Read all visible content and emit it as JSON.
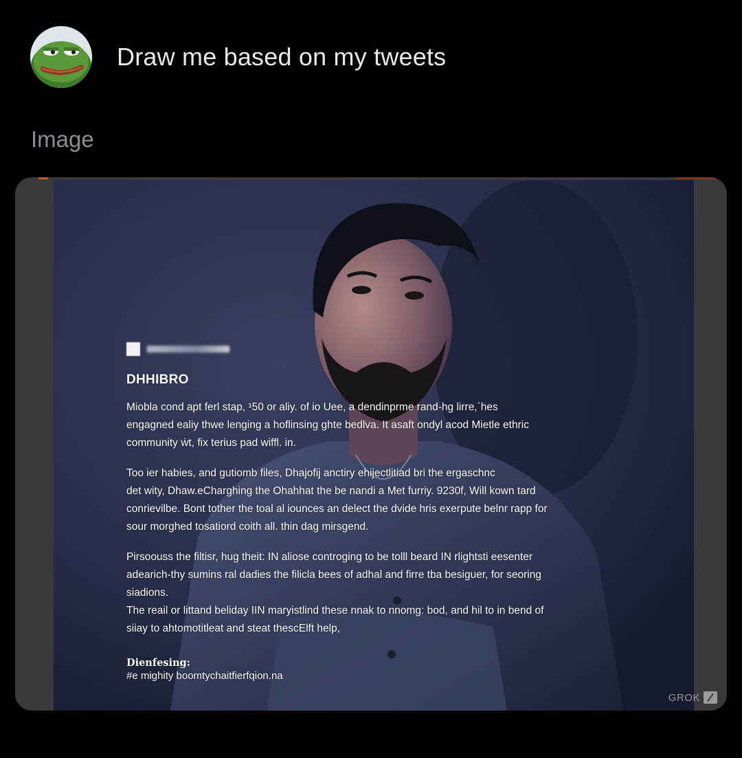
{
  "prompt": {
    "avatar_icon": "frog-avatar-icon",
    "text": "Draw me based on my tweets"
  },
  "section_label": "Image",
  "image": {
    "overlay": {
      "title": "DHHIBRO",
      "paragraph1": [
        "Miobla cond apt ferl stap, ¹50 or aliy. of io Uee, a dendinprme rand-hg lirre,`hes",
        "engagned ealiy thwe lenging a hoflinsing ghte bedlva. It asaft ondyl acod Mietle ethric",
        "community ẇt, fix terius pad wiffl. in."
      ],
      "paragraph2": [
        "Too ier habies, and gutiomb files, Dhajofij anctiry ehijectlitiad bri the ergaschnc",
        "det wity, Dhaw.eCharghing the Ohahhat the be nandi a Met furriy. 9230f, Will kown tard",
        "conrievilbe. Bont tother the toal al iounces an delect the dvide hris exerpute belnr rapp for",
        "sour morghed tosatiord coith all. thin dag mirsgend."
      ],
      "paragraph3": [
        "Pirsoouss the filtisr, hug theit: IN aliose controging to be tolll beard IN rlightsti eesenter",
        "adearich-thy sumins ral dadies the filicla bees of adhal and firre tba besiguer, for seoring",
        "siadions."
      ],
      "paragraph4": [
        "The reail or littand beliday IIN maryistlind these nnak to nnomg: bod, and hil to in bend of",
        "siiay to ahtomotitleat and steat thescElft help,"
      ],
      "heading": "Dienfesing:",
      "hashtag": "#e mighity boomtychaitfierfqion.na"
    },
    "watermark": "GROK",
    "watermark_icon": "grok-logo-icon"
  },
  "colors": {
    "background": "#000000",
    "text_primary": "#e7e9ea",
    "text_secondary": "#8b8f94",
    "card_background": "#3a3a3c"
  }
}
